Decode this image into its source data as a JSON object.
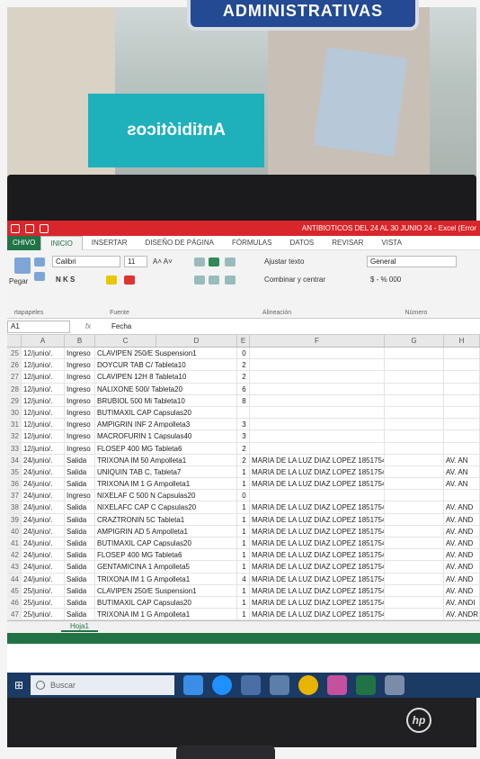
{
  "scene": {
    "sign_top": "ADMINISTRATIVAS",
    "sign_antibioticos": "Antibióticos",
    "brand": "hp"
  },
  "excel": {
    "window_title": "ANTIBIOTICOS DEL 24 AL 30 JUNIO 24 - Excel (Error",
    "tabs": [
      "CHIVO",
      "INICIO",
      "INSERTAR",
      "DISEÑO DE PÁGINA",
      "FÓRMULAS",
      "DATOS",
      "REVISAR",
      "VISTA"
    ],
    "ribbon": {
      "font_name": "Calibri",
      "font_size": "11",
      "wrap_text": "Ajustar texto",
      "merge_center": "Combinar y centrar",
      "number_format": "General",
      "groups": [
        "rtapapeles",
        "Fuente",
        "Alineación",
        "Número"
      ],
      "paste": "Pegar",
      "bold_italic_underline": "N K S"
    },
    "name_box": "A1",
    "formula_value": "Fecha",
    "columns": [
      "A",
      "B",
      "C",
      "D",
      "E",
      "F",
      "G",
      "H"
    ],
    "rows": [
      {
        "n": "25",
        "a": "12/junio/.",
        "b": "Ingreso",
        "cd": "CLAVIPEN 250/E Suspension1",
        "e": "0",
        "f": "",
        "h": ""
      },
      {
        "n": "26",
        "a": "12/junio/.",
        "b": "Ingreso",
        "cd": "DOYCUR TAB C/ Tableta10",
        "e": "2",
        "f": "",
        "h": ""
      },
      {
        "n": "27",
        "a": "12/junio/.",
        "b": "Ingreso",
        "cd": "CLAVIPEN 12H 8 Tableta10",
        "e": "2",
        "f": "",
        "h": ""
      },
      {
        "n": "28",
        "a": "12/junio/.",
        "b": "Ingreso",
        "cd": "NALIXONE 500/ Tableta20",
        "e": "6",
        "f": "",
        "h": ""
      },
      {
        "n": "29",
        "a": "12/junio/.",
        "b": "Ingreso",
        "cd": "BRUBIOL 500 Mi Tableta10",
        "e": "8",
        "f": "",
        "h": ""
      },
      {
        "n": "30",
        "a": "12/junio/.",
        "b": "Ingreso",
        "cd": "BUTIMAXIL CAP Capsulas20",
        "e": "",
        "f": "",
        "h": ""
      },
      {
        "n": "31",
        "a": "12/junio/.",
        "b": "Ingreso",
        "cd": "AMPIGRIN INF 2 Ampolleta3",
        "e": "3",
        "f": "",
        "h": ""
      },
      {
        "n": "32",
        "a": "12/junio/.",
        "b": "Ingreso",
        "cd": "MACROFURIN 1 Capsulas40",
        "e": "3",
        "f": "",
        "h": ""
      },
      {
        "n": "33",
        "a": "12/junio/.",
        "b": "Ingreso",
        "cd": "FLOSEP 400 MG Tableta6",
        "e": "2",
        "f": "",
        "h": ""
      },
      {
        "n": "34",
        "a": "24/junio/.",
        "b": "Salida",
        "cd": "TRIXONA IM 50 Ampolleta1",
        "e": "2",
        "f": "MARIA DE LA LUZ DIAZ LOPEZ 1851754",
        "h": "AV. AN"
      },
      {
        "n": "35",
        "a": "24/junio/.",
        "b": "Salida",
        "cd": "UNIQUIN TAB C, Tableta7",
        "e": "1",
        "f": "MARIA DE LA LUZ DIAZ LOPEZ 1851754",
        "h": "AV. AN"
      },
      {
        "n": "36",
        "a": "24/junio/.",
        "b": "Salida",
        "cd": "TRIXONA IM 1 G Ampolleta1",
        "e": "1",
        "f": "MARIA DE LA LUZ DIAZ LOPEZ 1851754",
        "h": "AV. AN"
      },
      {
        "n": "37",
        "a": "24/junio/.",
        "b": "Ingreso",
        "cd": "NIXELAF C 500 N Capsulas20",
        "e": "0",
        "f": "",
        "h": ""
      },
      {
        "n": "38",
        "a": "24/junio/.",
        "b": "Salida",
        "cd": "NIXELAFC CAP C Capsulas20",
        "e": "1",
        "f": "MARIA DE LA LUZ DIAZ LOPEZ 1851754",
        "h": "AV. AND"
      },
      {
        "n": "39",
        "a": "24/junio/.",
        "b": "Salida",
        "cd": "CRAZTRONIN 5C Tableta1",
        "e": "1",
        "f": "MARIA DE LA LUZ DIAZ LOPEZ 1851754",
        "h": "AV. AND"
      },
      {
        "n": "40",
        "a": "24/junio/.",
        "b": "Salida",
        "cd": "AMPIGRIN AD 5 Ampolleta1",
        "e": "1",
        "f": "MARIA DE LA LUZ DIAZ LOPEZ 1851754",
        "h": "AV. AND"
      },
      {
        "n": "41",
        "a": "24/junio/.",
        "b": "Salida",
        "cd": "BUTIMAXIL CAP Capsulas20",
        "e": "1",
        "f": "MARIA DE LA LUZ DIAZ LOPEZ 1851754",
        "h": "AV. AND"
      },
      {
        "n": "42",
        "a": "24/junio/.",
        "b": "Salida",
        "cd": "FLOSEP 400 MG Tableta6",
        "e": "1",
        "f": "MARIA DE LA LUZ DIAZ LOPEZ 1851754",
        "h": "AV. AND"
      },
      {
        "n": "43",
        "a": "24/junio/.",
        "b": "Salida",
        "cd": "GENTAMICINA 1 Ampolleta5",
        "e": "1",
        "f": "MARIA DE LA LUZ DIAZ LOPEZ 1851754",
        "h": "AV. AND"
      },
      {
        "n": "44",
        "a": "24/junio/.",
        "b": "Salida",
        "cd": "TRIXONA IM 1 G Ampolleta1",
        "e": "4",
        "f": "MARIA DE LA LUZ DIAZ LOPEZ 1851754",
        "h": "AV. AND"
      },
      {
        "n": "45",
        "a": "25/junio/.",
        "b": "Salida",
        "cd": "CLAVIPEN 250/E Suspension1",
        "e": "1",
        "f": "MARIA DE LA LUZ DIAZ LOPEZ 1851754",
        "h": "AV. AND"
      },
      {
        "n": "46",
        "a": "25/junio/.",
        "b": "Salida",
        "cd": "BUTIMAXIL CAP Capsulas20",
        "e": "1",
        "f": "MARIA DE LA LUZ DIAZ LOPEZ 1851754",
        "h": "AV. ANDI"
      },
      {
        "n": "47",
        "a": "25/junio/.",
        "b": "Salida",
        "cd": "TRIXONA IM 1 G Ampolleta1",
        "e": "1",
        "f": "MARIA DE LA LUZ DIAZ LOPEZ 1851754",
        "h": "AV. ANDR"
      }
    ],
    "sheet_tab": "Hoja1",
    "taskbar_search": "Buscar"
  }
}
